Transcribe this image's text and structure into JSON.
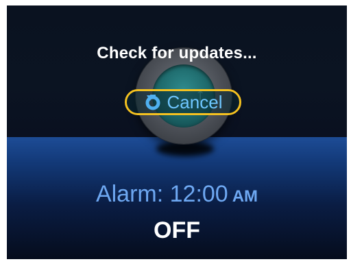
{
  "dialog": {
    "title": "Check for updates...",
    "cancel_label": "Cancel",
    "cancel_icon": "refresh-icon"
  },
  "alarm": {
    "label_prefix": "Alarm: ",
    "time": "12:00",
    "ampm": "AM",
    "status": "OFF"
  },
  "colors": {
    "accent_border": "#f4c120",
    "cancel_text": "#6fc6ff",
    "alarm_text": "#6ea8f2",
    "panel_blue": "#1d4c96"
  }
}
